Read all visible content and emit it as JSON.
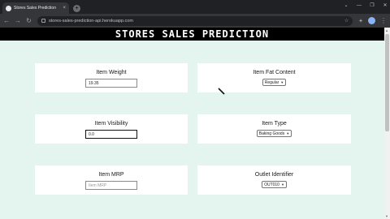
{
  "browser": {
    "tab_title": "Stores Sales Prediction",
    "tab_close": "×",
    "new_tab": "+",
    "url": "stores-sales-prediction-api.herokuapp.com",
    "window_controls": {
      "minimize": "—",
      "maximize": "❐",
      "close": "✕"
    },
    "tab_search": "⌄"
  },
  "page": {
    "banner_title": "STORES SALES PREDICTION",
    "fields": {
      "item_weight": {
        "label": "Item Weight",
        "value": "19.35"
      },
      "item_fat_content": {
        "label": "Item Fat Content",
        "selected": "Regular"
      },
      "item_visibility": {
        "label": "Item Visibility",
        "value": "0.0"
      },
      "item_type": {
        "label": "Item Type",
        "selected": "Baking Goods"
      },
      "item_mrp": {
        "label": "Item MRP",
        "placeholder": "Item MRP"
      },
      "outlet_identifier": {
        "label": "Outlet Identifier",
        "selected": "OUT010"
      }
    }
  },
  "colors": {
    "page_background": "#e4f5ef",
    "banner_background": "#000000",
    "card_background": "#ffffff"
  }
}
